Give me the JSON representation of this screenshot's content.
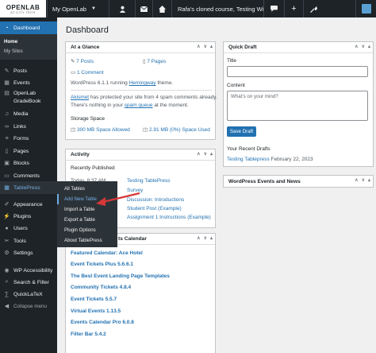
{
  "admin_bar": {
    "logo_main": "OPENLAB",
    "logo_sub": "AT CITY TECH",
    "my_sites": "My OpenLab",
    "site_name": "Rafa's cloned course, Testing Winter 2...",
    "icons": [
      "user-icon",
      "mail-icon",
      "home-icon",
      "comments-icon",
      "plus-icon",
      "tool-icon",
      "avatar"
    ]
  },
  "sidebar": {
    "dashboard": "Dashboard",
    "sub": {
      "home": "Home",
      "my_sites": "My Sites"
    },
    "items": [
      {
        "label": "Posts",
        "icon": "pushpin-icon"
      },
      {
        "label": "Events",
        "icon": "calendar-icon"
      },
      {
        "label": "OpenLab",
        "icon": "book-icon"
      },
      {
        "label": "GradeBook",
        "icon": ""
      },
      {
        "label": "Media",
        "icon": "media-icon"
      },
      {
        "label": "Links",
        "icon": "link-icon"
      },
      {
        "label": "Forms",
        "icon": "forms-icon"
      },
      {
        "label": "Pages",
        "icon": "page-icon"
      },
      {
        "label": "Blocks",
        "icon": "blocks-icon"
      },
      {
        "label": "Comments",
        "icon": "comment-icon"
      },
      {
        "label": "TablePress",
        "icon": "table-icon"
      },
      {
        "label": "Appearance",
        "icon": "brush-icon"
      },
      {
        "label": "Plugins",
        "icon": "plugin-icon"
      },
      {
        "label": "Users",
        "icon": "users-icon"
      },
      {
        "label": "Tools",
        "icon": "wrench-icon"
      },
      {
        "label": "Settings",
        "icon": "settings-icon"
      },
      {
        "label": "WP Accessibility",
        "icon": "accessibility-icon"
      },
      {
        "label": "Search & Filter",
        "icon": "search-icon"
      },
      {
        "label": "QuickLaTeX",
        "icon": "latex-icon"
      },
      {
        "label": "Collapse menu",
        "icon": "collapse-icon"
      }
    ]
  },
  "flyout": {
    "items": [
      "All Tables",
      "Add New Table",
      "Import a Table",
      "Export a Table",
      "Plugin Options",
      "About TablePress"
    ]
  },
  "page": {
    "title": "Dashboard"
  },
  "at_a_glance": {
    "title": "At a Glance",
    "posts": "7 Posts",
    "pages": "7 Pages",
    "comments": "1 Comment",
    "wp_version_pre": "WordPress 6.1.1 running ",
    "theme": "Hemingway",
    "wp_version_post": " theme.",
    "akismet_link": "Akismet",
    "akismet_text": " has protected your site from 4 spam comments already.",
    "spam_pre": "There's nothing in your ",
    "spam_link": "spam queue",
    "spam_post": " at the moment.",
    "storage_label": "Storage Space",
    "space_allowed": "300 MB Space Allowed",
    "space_used": "2.91 MB (0%) Space Used"
  },
  "activity": {
    "title": "Activity",
    "recently_published": "Recently Published",
    "rows": [
      {
        "date": "Today, 8:37 AM",
        "title": "Testing TablePress"
      },
      {
        "date": "",
        "title": "Survey"
      },
      {
        "date": "",
        "title": "Discussion: Introductions"
      },
      {
        "date": "",
        "title": "Student Post (Example)"
      },
      {
        "date": "",
        "title": "Assignment 1 Instructions (Example)"
      }
    ]
  },
  "events_calendar": {
    "title_tail": "ts Calendar",
    "items": [
      {
        "title": "Featured Calendar: Ace Hotel",
        "bold": true
      },
      {
        "title": "Event Tickets Plus 5.6.6.1",
        "bold": true
      },
      {
        "title": "The Best Event Landing Page Templates",
        "bold": true
      },
      {
        "title": "Community Tickets 4.8.4",
        "bold": true
      },
      {
        "title": "Event Tickets 5.5.7",
        "bold": true
      },
      {
        "title": "Virtual Events 1.13.5",
        "bold": true
      },
      {
        "title": "Events Calendar Pro 6.0.8",
        "bold": true
      },
      {
        "title": "Filter Bar 5.4.2",
        "bold": true
      }
    ]
  },
  "quick_draft": {
    "title": "Quick Draft",
    "title_label": "Title",
    "content_label": "Content",
    "content_placeholder": "What's on your mind?",
    "save_button": "Save Draft",
    "recent_heading": "Your Recent Drafts",
    "recent_link": "Testing Tablepress",
    "recent_date": "February 22, 2023"
  },
  "wp_events": {
    "title": "WordPress Events and News"
  },
  "colors": {
    "accent": "#2271b1",
    "arrow": "#d63638",
    "sidebar": "#1d2327"
  }
}
